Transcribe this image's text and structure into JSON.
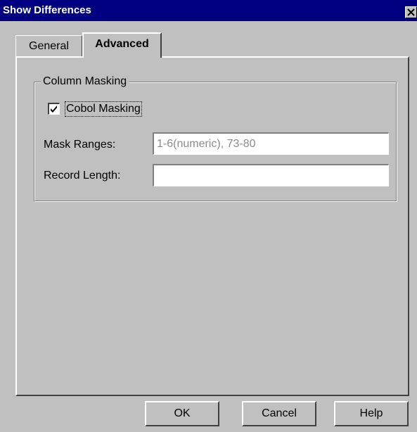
{
  "window": {
    "title": "Show Differences",
    "close_icon": "close-icon"
  },
  "tabs": [
    {
      "label": "General",
      "selected": false
    },
    {
      "label": "Advanced",
      "selected": true
    }
  ],
  "column_masking": {
    "group_label": "Column Masking",
    "cobol_masking": {
      "label": "Cobol Masking",
      "checked": true
    },
    "mask_ranges": {
      "label": "Mask Ranges:",
      "value": "1-6(numeric), 73-80",
      "enabled": false
    },
    "record_length": {
      "label": "Record Length:",
      "value": ""
    }
  },
  "buttons": {
    "ok": "OK",
    "cancel": "Cancel",
    "help": "Help"
  },
  "colors": {
    "titlebar": "#000080",
    "dialog_bg": "#c0c0c0",
    "disabled_text": "#8c8c8c"
  }
}
